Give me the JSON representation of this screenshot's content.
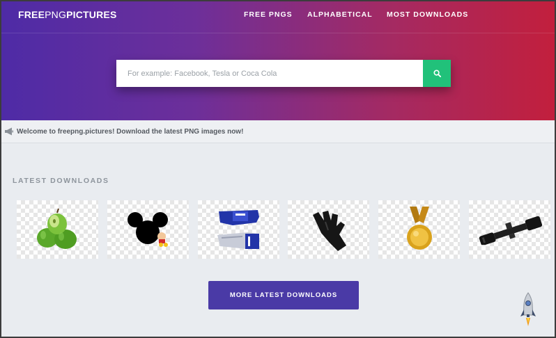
{
  "brand": {
    "logo_bold": "FREE",
    "logo_thin": "PNG",
    "logo_bold2": "PICTURES"
  },
  "nav": {
    "items": [
      {
        "label": "FREE PNGS"
      },
      {
        "label": "ALPHABETICAL"
      },
      {
        "label": "MOST DOWNLOADS"
      }
    ]
  },
  "search": {
    "placeholder": "For example: Facebook, Tesla or Coca Cola",
    "value": "",
    "button_icon": "search-icon"
  },
  "welcome": {
    "icon": "megaphone-icon",
    "text": "Welcome to freepng.pictures! Download the latest PNG images now!"
  },
  "latest": {
    "title": "LATEST DOWNLOADS",
    "items": [
      {
        "name": "green-apples",
        "icon": "apples-image"
      },
      {
        "name": "mickey-mouse",
        "icon": "mickey-image"
      },
      {
        "name": "racing-gloves",
        "icon": "gloves-image"
      },
      {
        "name": "rubber-glove",
        "icon": "glove-image"
      },
      {
        "name": "gold-medal",
        "icon": "medal-image"
      },
      {
        "name": "rifle-scope",
        "icon": "scope-image"
      }
    ],
    "more_label": "MORE LATEST DOWNLOADS"
  },
  "scroll_top": {
    "icon": "rocket-icon"
  },
  "colors": {
    "hero_start": "#4e2ba6",
    "hero_end": "#c21f3d",
    "search_button": "#21c17a",
    "more_button": "#4a3aa6",
    "page_bg": "#e9ecf0"
  }
}
